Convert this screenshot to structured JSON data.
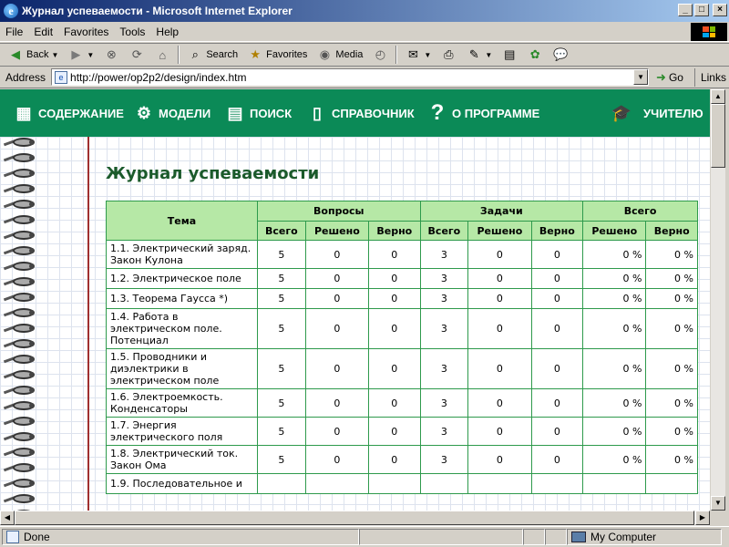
{
  "window": {
    "title": "Журнал успеваемости - Microsoft Internet Explorer"
  },
  "menu": [
    "File",
    "Edit",
    "Favorites",
    "Tools",
    "Help"
  ],
  "toolbar": {
    "back": "Back",
    "search": "Search",
    "favorites": "Favorites",
    "media": "Media"
  },
  "address": {
    "label": "Address",
    "url": "http://power/op2p2/design/index.htm",
    "go": "Go",
    "links": "Links"
  },
  "nav": [
    "СОДЕРЖАНИЕ",
    "МОДЕЛИ",
    "ПОИСК",
    "СПРАВОЧНИК",
    "О ПРОГРАММЕ",
    "УЧИТЕЛЮ"
  ],
  "page": {
    "heading": "Журнал успеваемости"
  },
  "table": {
    "col_topic": "Тема",
    "group_questions": "Вопросы",
    "group_tasks": "Задачи",
    "group_total": "Всего",
    "sub_total": "Всего",
    "sub_solved": "Решено",
    "sub_correct": "Верно",
    "rows": [
      {
        "topic": "1.1. Электрический заряд. Закон Кулона",
        "q_total": "5",
        "q_solved": "0",
        "q_correct": "0",
        "t_total": "3",
        "t_solved": "0",
        "t_correct": "0",
        "solved_pct": "0 %",
        "correct_pct": "0 %"
      },
      {
        "topic": "1.2. Электрическое поле",
        "q_total": "5",
        "q_solved": "0",
        "q_correct": "0",
        "t_total": "3",
        "t_solved": "0",
        "t_correct": "0",
        "solved_pct": "0 %",
        "correct_pct": "0 %"
      },
      {
        "topic": "1.3. Теорема Гаусса *)",
        "q_total": "5",
        "q_solved": "0",
        "q_correct": "0",
        "t_total": "3",
        "t_solved": "0",
        "t_correct": "0",
        "solved_pct": "0 %",
        "correct_pct": "0 %"
      },
      {
        "topic": "1.4. Работа в электрическом поле. Потенциал",
        "q_total": "5",
        "q_solved": "0",
        "q_correct": "0",
        "t_total": "3",
        "t_solved": "0",
        "t_correct": "0",
        "solved_pct": "0 %",
        "correct_pct": "0 %"
      },
      {
        "topic": "1.5. Проводники и диэлектрики в электрическом поле",
        "q_total": "5",
        "q_solved": "0",
        "q_correct": "0",
        "t_total": "3",
        "t_solved": "0",
        "t_correct": "0",
        "solved_pct": "0 %",
        "correct_pct": "0 %"
      },
      {
        "topic": "1.6. Электроемкость. Конденсаторы",
        "q_total": "5",
        "q_solved": "0",
        "q_correct": "0",
        "t_total": "3",
        "t_solved": "0",
        "t_correct": "0",
        "solved_pct": "0 %",
        "correct_pct": "0 %"
      },
      {
        "topic": "1.7. Энергия электрического поля",
        "q_total": "5",
        "q_solved": "0",
        "q_correct": "0",
        "t_total": "3",
        "t_solved": "0",
        "t_correct": "0",
        "solved_pct": "0 %",
        "correct_pct": "0 %"
      },
      {
        "topic": "1.8. Электрический ток. Закон Ома",
        "q_total": "5",
        "q_solved": "0",
        "q_correct": "0",
        "t_total": "3",
        "t_solved": "0",
        "t_correct": "0",
        "solved_pct": "0 %",
        "correct_pct": "0 %"
      },
      {
        "topic": "1.9. Последовательное и",
        "q_total": "",
        "q_solved": "",
        "q_correct": "",
        "t_total": "",
        "t_solved": "",
        "t_correct": "",
        "solved_pct": "",
        "correct_pct": ""
      }
    ]
  },
  "status": {
    "text": "Done",
    "zone": "My Computer"
  },
  "colors": {
    "nav_band": "#0b8a57",
    "table_header": "#b6e8a6",
    "table_border": "#2e9a4c",
    "heading": "#1b5a2b"
  }
}
